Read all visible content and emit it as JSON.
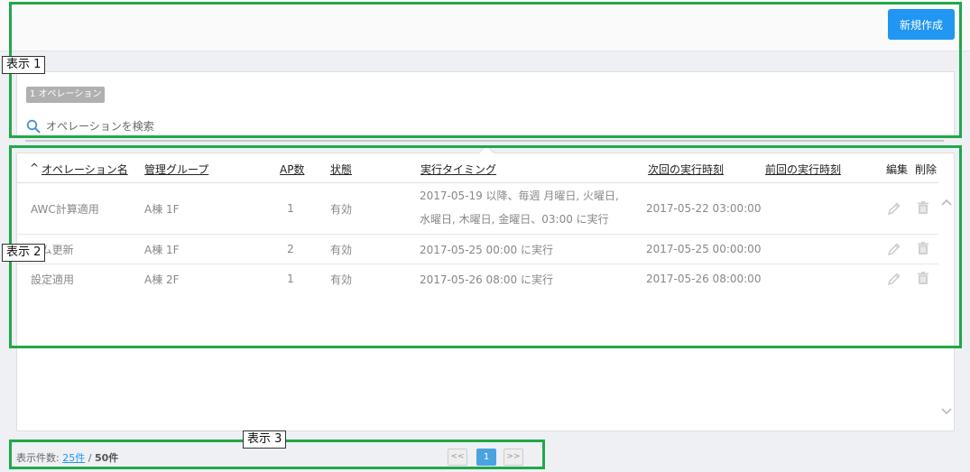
{
  "toolbar": {
    "new_label": "新規作成"
  },
  "filter": {
    "count_badge": "1 オペレーション",
    "search_placeholder": "オペレーションを検索"
  },
  "table": {
    "sort_indicator": "^",
    "columns": [
      "オペレーション名",
      "管理グループ",
      "AP数",
      "状態",
      "実行タイミング",
      "次回の実行時刻",
      "前回の実行時刻",
      "編集",
      "削除"
    ],
    "rows": [
      {
        "name": "AWC計算適用",
        "group": "A棟 1F",
        "ap": "1",
        "status": "有効",
        "timing": "2017-05-19 以降、毎週 月曜日, 火曜日, 水曜日, 木曜日, 金曜日、03:00 に実行",
        "next": "2017-05-22 03:00:00",
        "prev": ""
      },
      {
        "name": "ーム更新",
        "group": "A棟 1F",
        "ap": "2",
        "status": "有効",
        "timing": "2017-05-25 00:00 に実行",
        "next": "2017-05-25 00:00:00",
        "prev": ""
      },
      {
        "name": "設定適用",
        "group": "A棟 2F",
        "ap": "1",
        "status": "有効",
        "timing": "2017-05-26 08:00 に実行",
        "next": "2017-05-26 08:00:00",
        "prev": ""
      }
    ]
  },
  "footer": {
    "count_label": "表示件数:",
    "per_page": "25件",
    "separator": "/",
    "total": "50件"
  },
  "pagination": {
    "prev": "<<",
    "current": "1",
    "next": ">>"
  },
  "annotations": [
    "表示 1",
    "表示 2",
    "表示 3"
  ],
  "colors": {
    "accent": "#2196f3",
    "annotation": "#21a84a"
  }
}
